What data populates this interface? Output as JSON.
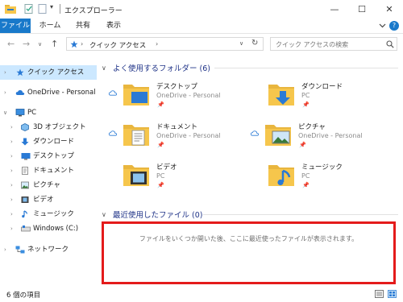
{
  "window": {
    "title": "エクスプローラー",
    "controls": {
      "minimize": "—",
      "maximize": "☐",
      "close": "✕"
    }
  },
  "ribbon": {
    "tabs": [
      {
        "label": "ファイル",
        "active": true
      },
      {
        "label": "ホーム"
      },
      {
        "label": "共有"
      },
      {
        "label": "表示"
      }
    ],
    "collapse_icon": "chevron-down",
    "help_icon": "?"
  },
  "address_bar": {
    "back": "←",
    "forward": "→",
    "recent": "∨",
    "up": "↑",
    "path": [
      "クイック アクセス"
    ],
    "separator": "›",
    "dropdown": "∨",
    "refresh": "↻"
  },
  "search": {
    "placeholder": "クイック アクセスの検索"
  },
  "sidebar": {
    "items": [
      {
        "label": "クイック アクセス",
        "icon": "star-icon",
        "selected": true
      },
      {
        "label": "OneDrive - Personal",
        "icon": "cloud-icon"
      },
      {
        "label": "PC",
        "icon": "pc-icon",
        "expanded": true
      },
      {
        "label": "3D オブジェクト",
        "icon": "3d-objects-icon"
      },
      {
        "label": "ダウンロード",
        "icon": "download-icon"
      },
      {
        "label": "デスクトップ",
        "icon": "desktop-icon"
      },
      {
        "label": "ドキュメント",
        "icon": "document-icon"
      },
      {
        "label": "ピクチャ",
        "icon": "picture-icon"
      },
      {
        "label": "ビデオ",
        "icon": "video-icon"
      },
      {
        "label": "ミュージック",
        "icon": "music-icon"
      },
      {
        "label": "Windows (C:)",
        "icon": "drive-icon"
      },
      {
        "label": "ネットワーク",
        "icon": "network-icon"
      }
    ]
  },
  "frequent": {
    "header": "よく使用するフォルダー (6)",
    "folders": [
      {
        "name": "デスクトップ",
        "sub": "OneDrive - Personal",
        "cloud": true,
        "icon": "desktop-folder-icon"
      },
      {
        "name": "ダウンロード",
        "sub": "PC",
        "cloud": false,
        "icon": "download-folder-icon"
      },
      {
        "name": "ドキュメント",
        "sub": "OneDrive - Personal",
        "cloud": true,
        "icon": "document-folder-icon"
      },
      {
        "name": "ピクチャ",
        "sub": "OneDrive - Personal",
        "cloud": true,
        "icon": "picture-folder-icon"
      },
      {
        "name": "ビデオ",
        "sub": "PC",
        "cloud": false,
        "icon": "video-folder-icon"
      },
      {
        "name": "ミュージック",
        "sub": "PC",
        "cloud": false,
        "icon": "music-folder-icon"
      }
    ]
  },
  "recent": {
    "header": "最近使用したファイル (0)",
    "empty_message": "ファイルをいくつか開いた後、ここに最近使ったファイルが表示されます。",
    "highlight_color": "#e41b1b"
  },
  "status": {
    "item_count": "6 個の項目"
  },
  "colors": {
    "accent": "#1979ca",
    "header": "#1e3287",
    "selected": "#cce8ff",
    "folder": "#f6c64c"
  }
}
